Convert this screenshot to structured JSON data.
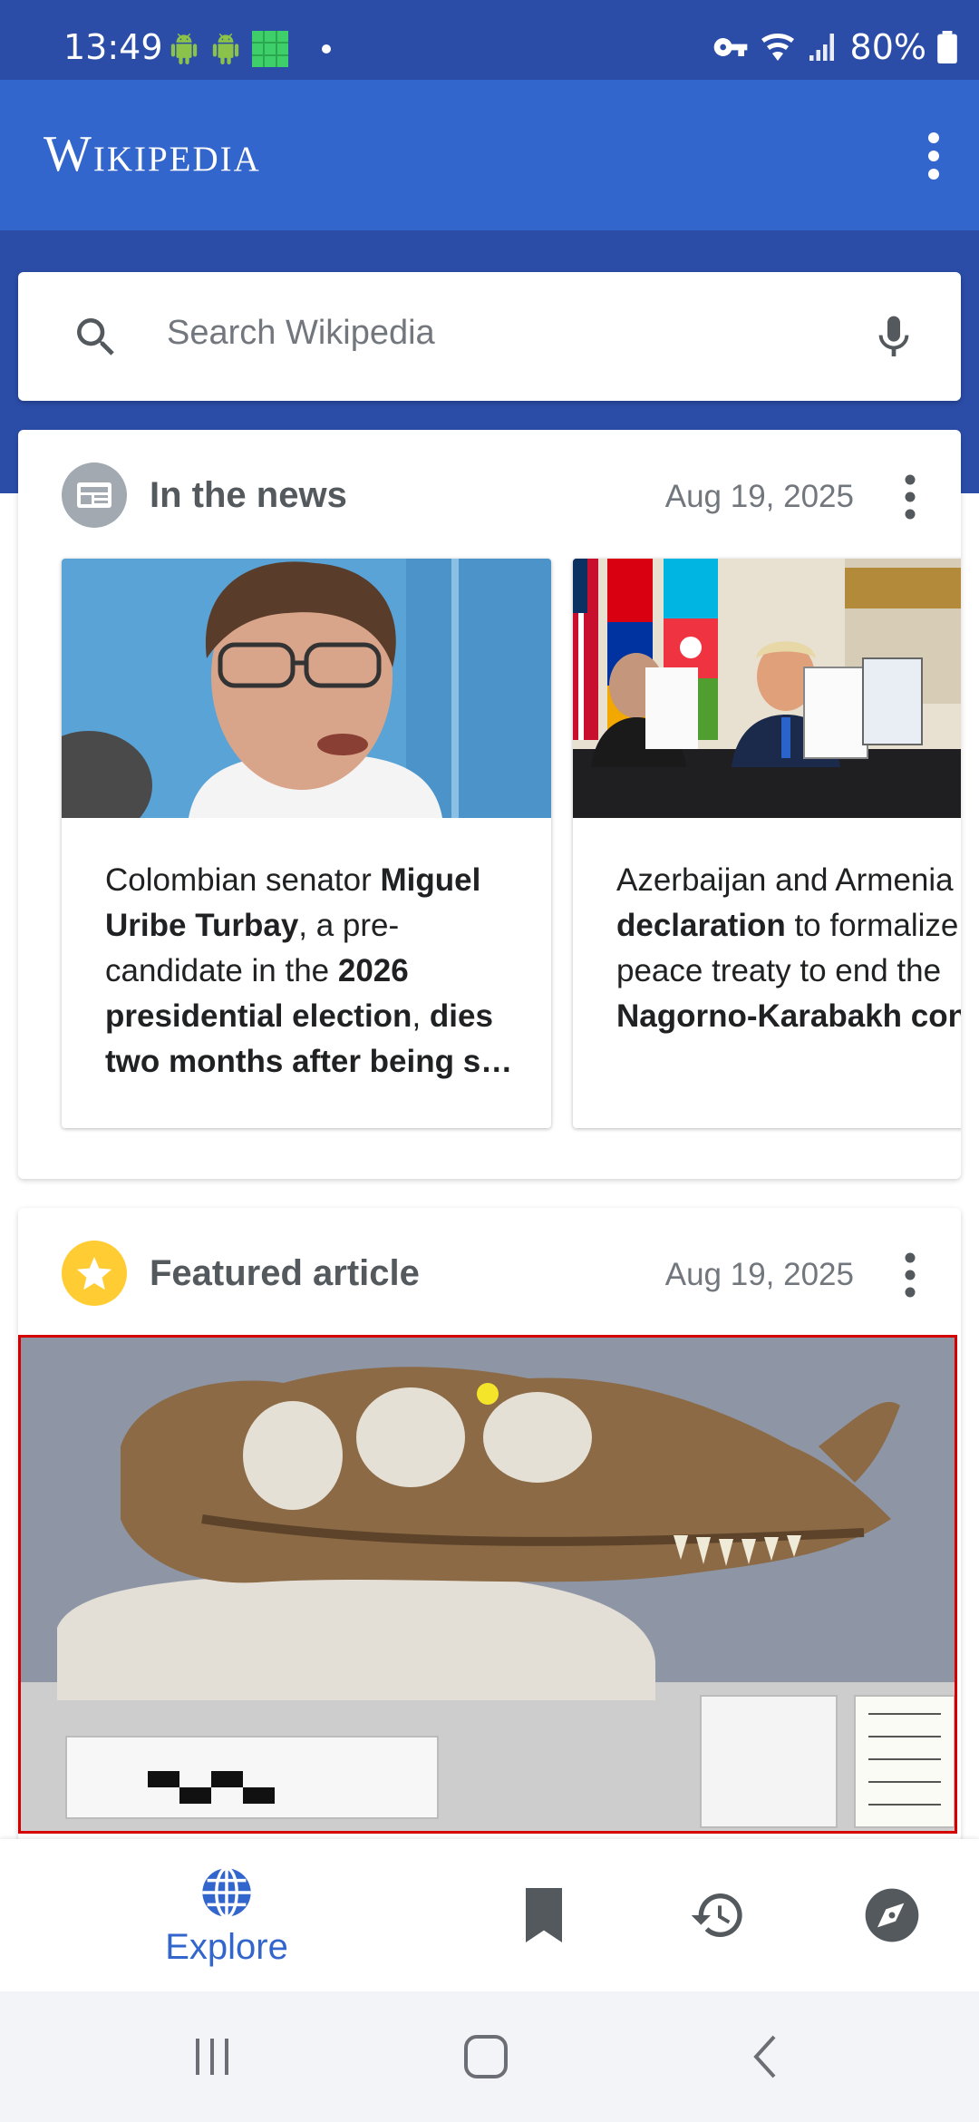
{
  "status": {
    "time": "13:49",
    "battery": "80%",
    "notification_icons": [
      "android-icon",
      "android-icon",
      "app-grid-icon",
      "dot-icon"
    ],
    "system_icons": [
      "vpn-key-icon",
      "wifi-icon",
      "signal-icon",
      "battery-icon"
    ]
  },
  "app_bar": {
    "title": "Wikipedia"
  },
  "search": {
    "placeholder": "Search Wikipedia"
  },
  "news_card": {
    "title": "In the news",
    "date": "Aug 19, 2025",
    "items": [
      {
        "segments": [
          {
            "text": "Colombian senator ",
            "bold": false
          },
          {
            "text": "Miguel Uribe Turbay",
            "bold": true
          },
          {
            "text": ", a pre-candidate in the ",
            "bold": false
          },
          {
            "text": "2026 presidential election",
            "bold": true
          },
          {
            "text": ", ",
            "bold": false
          },
          {
            "text": "dies two months after being s…",
            "bold": true
          }
        ]
      },
      {
        "segments": [
          {
            "text": "Azerbaijan and Armenia sign ",
            "bold": false
          },
          {
            "text": "a declaration",
            "bold": true
          },
          {
            "text": " to formalize a future peace treaty to end the ",
            "bold": false
          },
          {
            "text": "Nagorno-Karabakh conf",
            "bold": true
          }
        ]
      }
    ]
  },
  "featured_card": {
    "title": "Featured article",
    "date": "Aug 19, 2025"
  },
  "bottom_nav": {
    "explore_label": "Explore",
    "accent": "#3366cc"
  }
}
